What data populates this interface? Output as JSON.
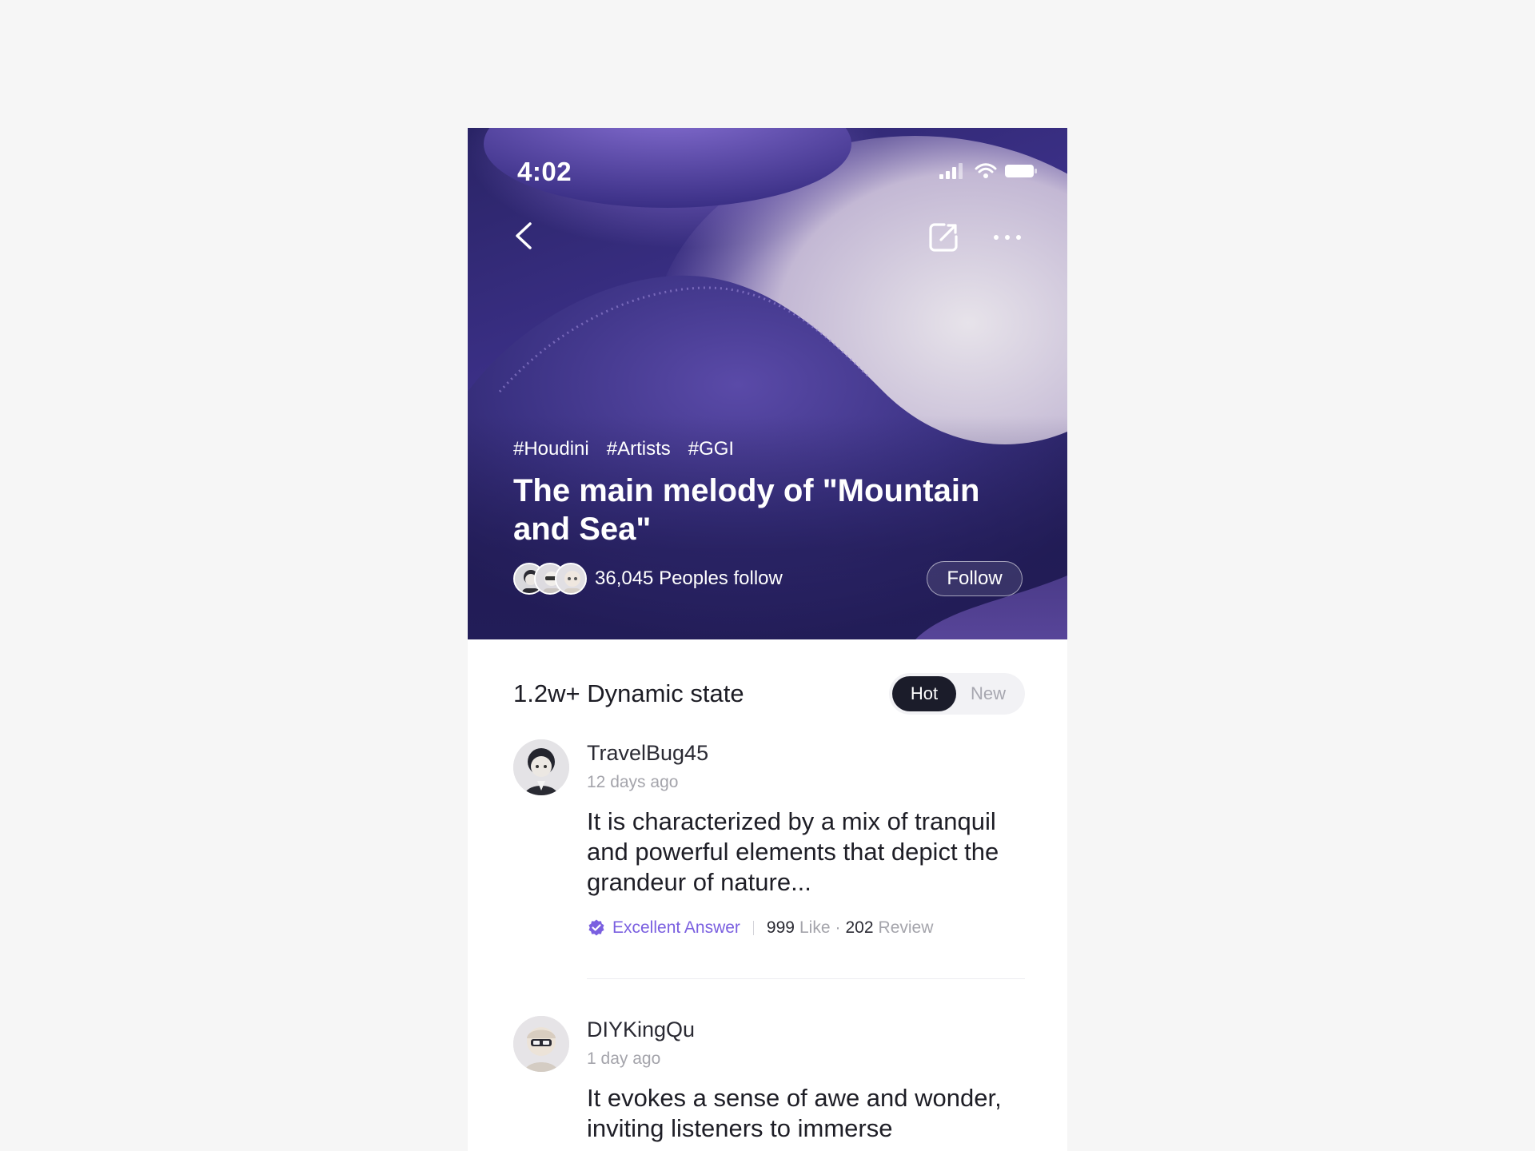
{
  "status_bar": {
    "time": "4:02"
  },
  "hero": {
    "tags": [
      "#Houdini",
      "#Artists",
      "#GGI"
    ],
    "title": "The main melody of \"Mountain and Sea\"",
    "followers_text": "36,045 Peoples follow",
    "follow_label": "Follow"
  },
  "section": {
    "title": "1.2w+ Dynamic state",
    "sort_options": [
      "Hot",
      "New"
    ],
    "active_sort": "Hot"
  },
  "posts": [
    {
      "username": "TravelBug45",
      "time": "12 days ago",
      "body": "It is characterized by a mix of tranquil and powerful elements that depict the grandeur of nature...",
      "badge": "Excellent Answer",
      "likes": "999",
      "likes_label": "Like",
      "reviews": "202",
      "reviews_label": "Review"
    },
    {
      "username": "DIYKingQu",
      "time": "1 day ago",
      "body": "It evokes a sense of awe and wonder, inviting listeners to immerse"
    }
  ],
  "colors": {
    "accent": "#7a5fe0",
    "dark": "#1b1c2a",
    "hero": "#3a2f85"
  }
}
